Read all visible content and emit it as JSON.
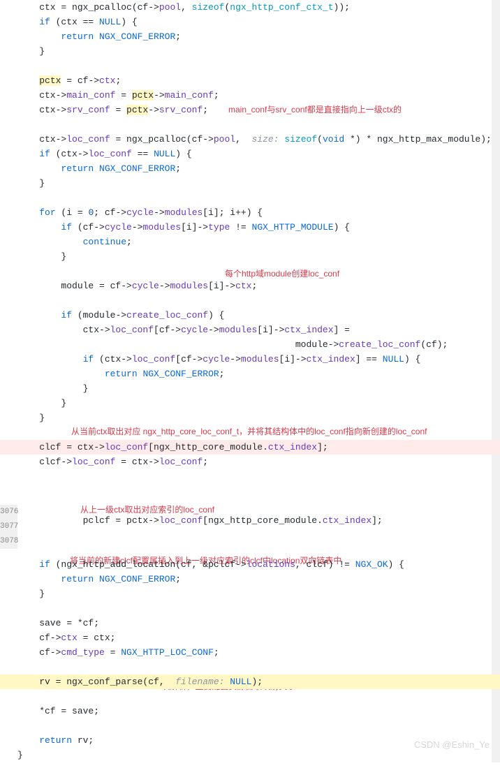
{
  "code": {
    "l1_a": "    ctx = ngx_pcalloc(cf->",
    "l1_b": "pool",
    "l1_c": ", ",
    "l1_d": "sizeof",
    "l1_e": "(",
    "l1_f": "ngx_http_conf_ctx_t",
    "l1_g": "));",
    "l2_a": "    ",
    "l2_b": "if",
    "l2_c": " (ctx == ",
    "l2_d": "NULL",
    "l2_e": ") {",
    "l3_a": "        ",
    "l3_b": "return",
    "l3_c": " ",
    "l3_d": "NGX_CONF_ERROR",
    "l3_e": ";",
    "l4": "    }",
    "l5": "",
    "l6_a": "    ",
    "l6_b": "pctx",
    "l6_c": " = cf->",
    "l6_d": "ctx",
    "l6_e": ";",
    "l7_a": "    ctx->",
    "l7_b": "main_conf",
    "l7_c": " = ",
    "l7_d": "pctx",
    "l7_e": "->",
    "l7_f": "main_conf",
    "l7_g": ";",
    "l8_a": "    ctx->",
    "l8_b": "srv_conf",
    "l8_c": " = ",
    "l8_d": "pctx",
    "l8_e": "->",
    "l8_f": "srv_conf",
    "l8_g": ";",
    "l9": "",
    "l10_a": "    ctx->",
    "l10_b": "loc_conf",
    "l10_c": " = ngx_pcalloc(cf->",
    "l10_d": "pool",
    "l10_e": ",  ",
    "l10_hint": "size:",
    "l10_f": " ",
    "l10_g": "sizeof",
    "l10_h": "(",
    "l10_i": "void",
    "l10_j": " *) * ngx_http_max_module);",
    "l11_a": "    ",
    "l11_b": "if",
    "l11_c": " (ctx->",
    "l11_d": "loc_conf",
    "l11_e": " == ",
    "l11_f": "NULL",
    "l11_g": ") {",
    "l12_a": "        ",
    "l12_b": "return",
    "l12_c": " ",
    "l12_d": "NGX_CONF_ERROR",
    "l12_e": ";",
    "l13": "    }",
    "l14": "",
    "l15_a": "    ",
    "l15_b": "for",
    "l15_c": " (i = ",
    "l15_d": "0",
    "l15_e": "; cf->",
    "l15_f": "cycle",
    "l15_g": "->",
    "l15_h": "modules",
    "l15_i": "[i]; i++) {",
    "l16_a": "        ",
    "l16_b": "if",
    "l16_c": " (cf->",
    "l16_d": "cycle",
    "l16_e": "->",
    "l16_f": "modules",
    "l16_g": "[i]->",
    "l16_h": "type",
    "l16_i": " != ",
    "l16_j": "NGX_HTTP_MODULE",
    "l16_k": ") {",
    "l17_a": "            ",
    "l17_b": "continue",
    "l17_c": ";",
    "l18": "        }",
    "l19": "",
    "l20_a": "        module = cf->",
    "l20_b": "cycle",
    "l20_c": "->",
    "l20_d": "modules",
    "l20_e": "[i]->",
    "l20_f": "ctx",
    "l20_g": ";",
    "l21": "",
    "l22_a": "        ",
    "l22_b": "if",
    "l22_c": " (module->",
    "l22_d": "create_loc_conf",
    "l22_e": ") {",
    "l23_a": "            ctx->",
    "l23_b": "loc_conf",
    "l23_c": "[cf->",
    "l23_d": "cycle",
    "l23_e": "->",
    "l23_f": "modules",
    "l23_g": "[i]->",
    "l23_h": "ctx_index",
    "l23_i": "] =",
    "l24_a": "                                                   module->",
    "l24_b": "create_loc_conf",
    "l24_c": "(cf);",
    "l25_a": "            ",
    "l25_b": "if",
    "l25_c": " (ctx->",
    "l25_d": "loc_conf",
    "l25_e": "[cf->",
    "l25_f": "cycle",
    "l25_g": "->",
    "l25_h": "modules",
    "l25_i": "[i]->",
    "l25_j": "ctx_index",
    "l25_k": "] == ",
    "l25_l": "NULL",
    "l25_m": ") {",
    "l26_a": "                ",
    "l26_b": "return",
    "l26_c": " ",
    "l26_d": "NGX_CONF_ERROR",
    "l26_e": ";",
    "l27": "            }",
    "l28": "        }",
    "l29": "    }",
    "l30": "",
    "l31_a": "    clcf = ctx->",
    "l31_b": "loc_conf",
    "l31_c": "[ngx_http_core_module.",
    "l31_d": "ctx_index",
    "l31_e": "];",
    "l32_a": "    clcf->",
    "l32_b": "loc_conf",
    "l32_c": " = ctx->",
    "l32_d": "loc_conf",
    "l32_e": ";",
    "l33": "",
    "l34": "",
    "l35_a": "            pclcf = pctx->",
    "l35_b": "loc_conf",
    "l35_c": "[ngx_http_core_module.",
    "l35_d": "ctx_index",
    "l35_e": "];",
    "l36": "",
    "l37": "",
    "l38_a": "    ",
    "l38_b": "if",
    "l38_c": " (ngx_http_add_location(cf, &pclcf->",
    "l38_d": "locations",
    "l38_e": ", clcf) != ",
    "l38_f": "NGX_OK",
    "l38_g": ") {",
    "l39_a": "        ",
    "l39_b": "return",
    "l39_c": " ",
    "l39_d": "NGX_CONF_ERROR",
    "l39_e": ";",
    "l40": "    }",
    "l41": "",
    "l42": "    save = *cf;",
    "l43_a": "    cf->",
    "l43_b": "ctx",
    "l43_c": " = ctx;",
    "l44_a": "    cf->",
    "l44_b": "cmd_type",
    "l44_c": " = ",
    "l44_d": "NGX_HTTP_LOC_CONF",
    "l44_e": ";",
    "l45": "",
    "l46_a": "    rv = ngx_conf_parse(cf,  ",
    "l46_hint": "filename:",
    "l46_b": " ",
    "l46_c": "NULL",
    "l46_d": ");",
    "l47": "",
    "l48": "    *cf = save;",
    "l49": "",
    "l50_a": "    ",
    "l50_b": "return",
    "l50_c": " rv;",
    "l51": "}"
  },
  "annotations": {
    "a1": "main_conf与srv_conf都是直接指向上一级ctx的",
    "a2": "每个http域module创建loc_conf",
    "a3": "从当前ctx取出对应 ngx_http_core_loc_conf_t，并将其结构体中的loc_conf指向新创建的loc_conf",
    "a4": "从上一级ctx取出对应索引的loc_conf",
    "a5": "将当前的新建clcf配置尾插入到上一级对应索引的clcf中location双向链表中",
    "a6": "location块解析，主要配置资源目录映射关系"
  },
  "line_numbers": {
    "n1": "3076",
    "n2": "3077",
    "n3": "3078"
  },
  "watermark": "CSDN @Eshin_Ye"
}
